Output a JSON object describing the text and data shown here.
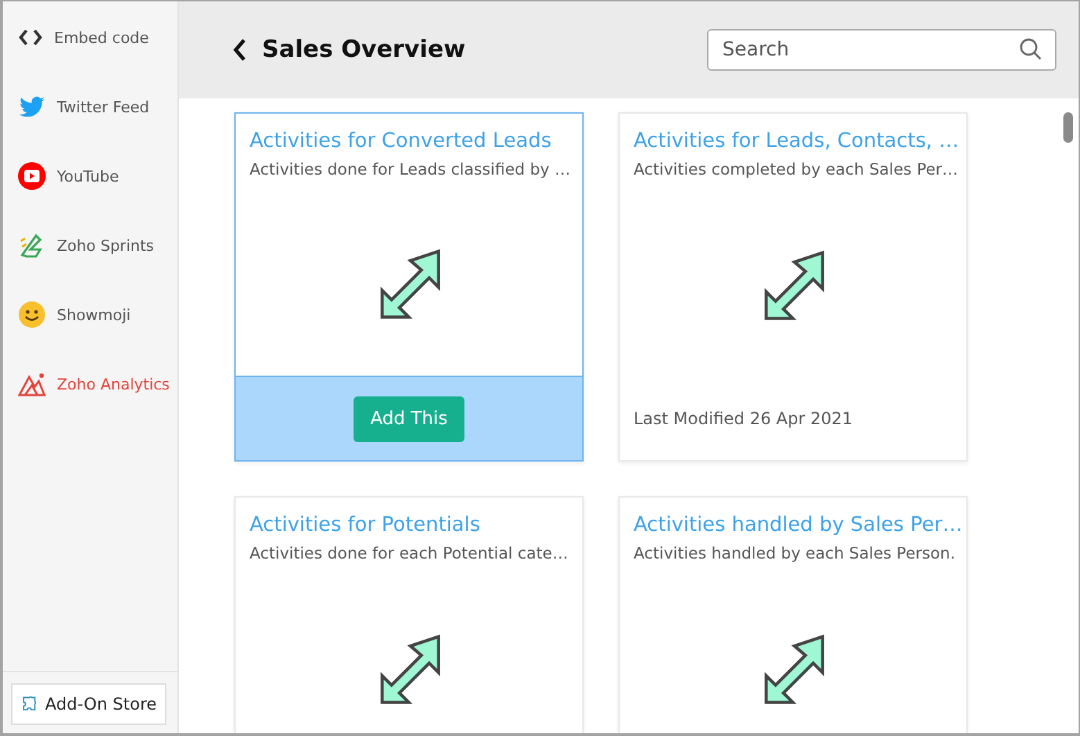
{
  "sidebar": {
    "items": [
      {
        "kind": "embed",
        "label": "Embed code",
        "selected": false
      },
      {
        "kind": "twitter",
        "label": "Twitter Feed",
        "selected": false
      },
      {
        "kind": "youtube",
        "label": "YouTube",
        "selected": false
      },
      {
        "kind": "sprints",
        "label": "Zoho Sprints",
        "selected": false
      },
      {
        "kind": "showmoji",
        "label": "Showmoji",
        "selected": false
      },
      {
        "kind": "analytics",
        "label": "Zoho Analytics",
        "selected": true
      }
    ],
    "store_button": "Add-On Store"
  },
  "header": {
    "title": "Sales Overview",
    "search": {
      "placeholder": "Search"
    }
  },
  "cards": [
    {
      "title": "Activities for Converted Leads",
      "description": "Activities done for Leads classified by …",
      "highlighted": true,
      "action": "Add This"
    },
    {
      "title": "Activities for Leads, Contacts, …",
      "description": "Activities completed by each Sales Per…",
      "highlighted": false,
      "last_modified": "Last Modified 26 Apr 2021"
    },
    {
      "title": "Activities for Potentials",
      "description": "Activities done for each Potential cate…",
      "highlighted": false
    },
    {
      "title": "Activities handled by Sales Per…",
      "description": "Activities handled by each Sales Person.",
      "highlighted": false
    }
  ]
}
